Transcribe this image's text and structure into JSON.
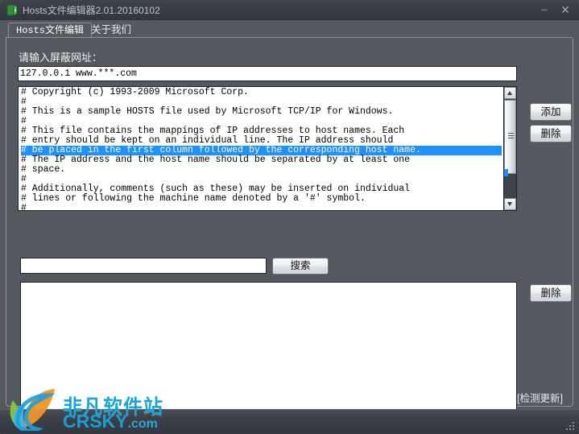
{
  "window": {
    "title": "Hosts文件编辑器2.01.20160102",
    "icon": "hosts-editor-icon",
    "minimize_label": "–",
    "close_label": "✕"
  },
  "tabs": [
    {
      "label": "Hosts文件编辑",
      "active": true
    },
    {
      "label": "关于我们",
      "active": false
    }
  ],
  "main": {
    "url_label": "请输入屏蔽网址：",
    "url_input_value": "127.0.0.1 www.***.com",
    "url_input_placeholder": "",
    "add_button": "添加",
    "delete_button_top": "删除",
    "delete_button_bottom": "删除",
    "search_button": "搜索",
    "search_input_value": "",
    "search_input_placeholder": "",
    "update_link": "[检测更新]",
    "hosts_lines": [
      {
        "text": "# Copyright (c) 1993-2009 Microsoft Corp.",
        "highlighted": false
      },
      {
        "text": "#",
        "highlighted": false
      },
      {
        "text": "# This is a sample HOSTS file used by Microsoft TCP/IP for Windows.",
        "highlighted": false
      },
      {
        "text": "#",
        "highlighted": false
      },
      {
        "text": "# This file contains the mappings of IP addresses to host names. Each",
        "highlighted": false
      },
      {
        "text": "# entry should be kept on an individual line. The IP address should",
        "highlighted": false
      },
      {
        "text": "# be placed in the first column followed by the corresponding host name.",
        "highlighted": true
      },
      {
        "text": "# The IP address and the host name should be separated by at least one",
        "highlighted": false
      },
      {
        "text": "# space.",
        "highlighted": false
      },
      {
        "text": "#",
        "highlighted": false
      },
      {
        "text": "# Additionally, comments (such as these) may be inserted on individual",
        "highlighted": false
      },
      {
        "text": "# lines or following the machine name denoted by a '#' symbol.",
        "highlighted": false
      },
      {
        "text": "#",
        "highlighted": false
      }
    ],
    "result_list_items": []
  },
  "watermark": {
    "text_cn": "非凡软件站",
    "text_en": "CRSKY",
    "text_en_suffix": ".com",
    "brand_color": "#16a5d8"
  },
  "colors": {
    "window_background": "#54585f",
    "titlebar": "#373c45",
    "highlight": "#1e90ff",
    "text_light": "#f0f2f4"
  }
}
